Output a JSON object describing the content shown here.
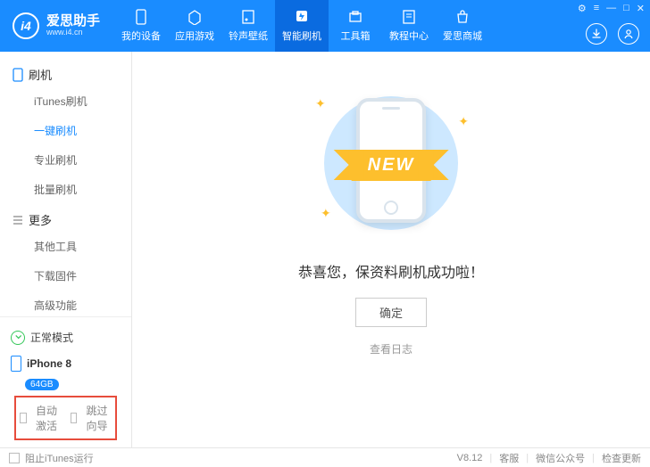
{
  "app": {
    "title": "爱思助手",
    "subtitle": "www.i4.cn"
  },
  "nav": [
    {
      "label": "我的设备",
      "icon": "phone"
    },
    {
      "label": "应用游戏",
      "icon": "apps"
    },
    {
      "label": "铃声壁纸",
      "icon": "music"
    },
    {
      "label": "智能刷机",
      "icon": "flash",
      "active": true
    },
    {
      "label": "工具箱",
      "icon": "tools"
    },
    {
      "label": "教程中心",
      "icon": "book"
    },
    {
      "label": "爱思商城",
      "icon": "shop"
    }
  ],
  "sidebar": {
    "group1": {
      "title": "刷机"
    },
    "items1": [
      "iTunes刷机",
      "一键刷机",
      "专业刷机",
      "批量刷机"
    ],
    "active1": 1,
    "group2": {
      "title": "更多"
    },
    "items2": [
      "其他工具",
      "下载固件",
      "高级功能"
    ],
    "mode": "正常模式",
    "device": "iPhone 8",
    "storage": "64GB",
    "checks": {
      "auto_activate": "自动激活",
      "skip_guide": "跳过向导"
    }
  },
  "main": {
    "ribbon": "NEW",
    "success": "恭喜您，保资料刷机成功啦！",
    "ok": "确定",
    "log": "查看日志"
  },
  "footer": {
    "block_itunes": "阻止iTunes运行",
    "version": "V8.12",
    "support": "客服",
    "wechat": "微信公众号",
    "update": "检查更新"
  }
}
